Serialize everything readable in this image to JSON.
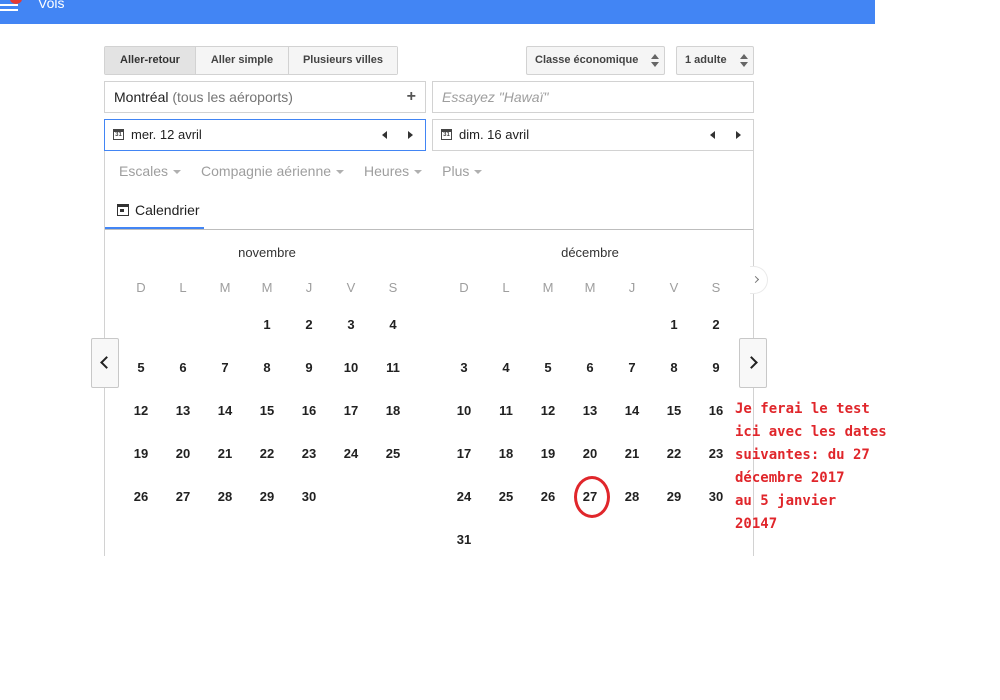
{
  "app": {
    "title": "Vols"
  },
  "trip_types": [
    {
      "label": "Aller-retour",
      "active": true
    },
    {
      "label": "Aller simple",
      "active": false
    },
    {
      "label": "Plusieurs villes",
      "active": false
    }
  ],
  "cabin": {
    "value": "Classe économique"
  },
  "passengers": {
    "value": "1 adulte"
  },
  "origin": {
    "city": "Montréal",
    "suffix": "(tous les aéroports)",
    "add_icon": "+"
  },
  "destination": {
    "placeholder": "Essayez \"Hawaï\""
  },
  "departure": {
    "date": "mer. 12 avril",
    "icon_text": "31"
  },
  "return": {
    "date": "dim. 16 avril",
    "icon_text": "31"
  },
  "filters": [
    "Escales",
    "Compagnie aérienne",
    "Heures",
    "Plus"
  ],
  "calendar_tab": {
    "label": "Calendrier"
  },
  "weekdays": [
    "D",
    "L",
    "M",
    "M",
    "J",
    "V",
    "S"
  ],
  "months": [
    {
      "name": "novembre",
      "weeks": [
        [
          "",
          "",
          "",
          "1",
          "2",
          "3",
          "4"
        ],
        [
          "5",
          "6",
          "7",
          "8",
          "9",
          "10",
          "11"
        ],
        [
          "12",
          "13",
          "14",
          "15",
          "16",
          "17",
          "18"
        ],
        [
          "19",
          "20",
          "21",
          "22",
          "23",
          "24",
          "25"
        ],
        [
          "26",
          "27",
          "28",
          "29",
          "30",
          "",
          ""
        ]
      ]
    },
    {
      "name": "décembre",
      "weeks": [
        [
          "",
          "",
          "",
          "",
          "",
          "1",
          "2"
        ],
        [
          "3",
          "4",
          "5",
          "6",
          "7",
          "8",
          "9"
        ],
        [
          "10",
          "11",
          "12",
          "13",
          "14",
          "15",
          "16"
        ],
        [
          "17",
          "18",
          "19",
          "20",
          "21",
          "22",
          "23"
        ],
        [
          "24",
          "25",
          "26",
          "27",
          "28",
          "29",
          "30"
        ],
        [
          "31",
          "",
          "",
          "",
          "",
          "",
          ""
        ]
      ]
    }
  ],
  "annotation": {
    "lines": [
      "Je ferai le test",
      "ici avec les dates",
      "suivantes: du 27",
      "décembre 2017",
      "au 5 janvier",
      "20147"
    ],
    "color": "#e0262b"
  },
  "colors": {
    "topbar": "#4285f4",
    "accent": "#4285f4",
    "annotation": "#e0262b"
  },
  "icons": {
    "menu": "menu-icon",
    "prev": "chevron-left-icon",
    "next": "chevron-right-icon",
    "calendar": "calendar-icon"
  }
}
